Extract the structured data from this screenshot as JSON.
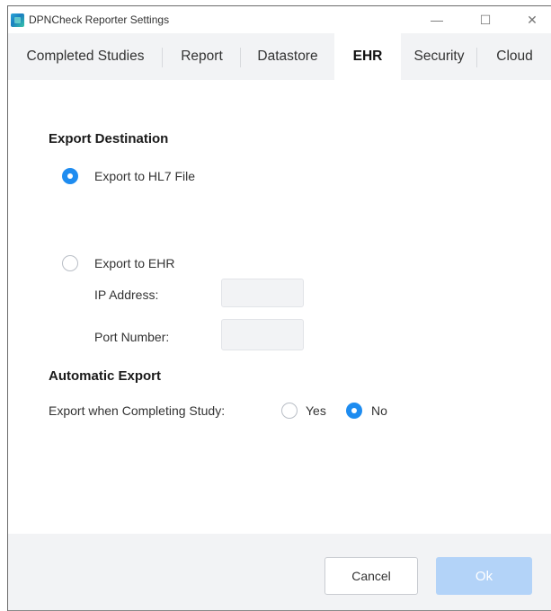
{
  "window": {
    "title": "DPNCheck Reporter Settings",
    "controls": {
      "minimize": "—",
      "maximize": "☐",
      "close": "✕"
    }
  },
  "tabs": [
    {
      "label": "Completed Studies",
      "active": false
    },
    {
      "label": "Report",
      "active": false
    },
    {
      "label": "Datastore",
      "active": false
    },
    {
      "label": "EHR",
      "active": true
    },
    {
      "label": "Security",
      "active": false
    },
    {
      "label": "Cloud",
      "active": false
    }
  ],
  "export_destination": {
    "title": "Export Destination",
    "options": [
      {
        "label": "Export to HL7 File",
        "selected": true
      },
      {
        "label": "Export to EHR",
        "selected": false
      }
    ],
    "ip_address_label": "IP Address:",
    "ip_address_value": "",
    "port_number_label": "Port Number:",
    "port_number_value": ""
  },
  "automatic_export": {
    "title": "Automatic Export",
    "question": "Export when Completing Study:",
    "options": [
      {
        "label": "Yes",
        "selected": false
      },
      {
        "label": "No",
        "selected": true
      }
    ]
  },
  "footer": {
    "cancel_label": "Cancel",
    "ok_label": "Ok"
  },
  "colors": {
    "accent": "#1e8cf0",
    "ok_disabled": "#b3d3f8",
    "tab_bar": "#f2f3f5"
  }
}
